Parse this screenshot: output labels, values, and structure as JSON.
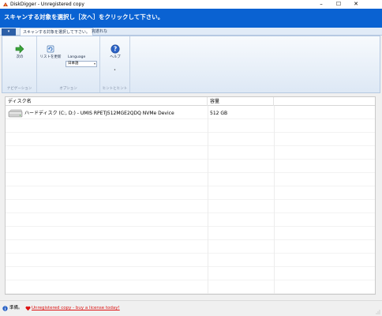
{
  "window": {
    "title": "DiskDigger - Unregistered copy",
    "controls": {
      "minimize": "–",
      "maximize": "☐",
      "close": "✕"
    }
  },
  "banner": {
    "text": "スキャンする対象を選択し［次へ］をクリックして下さい。"
  },
  "ribbon": {
    "file_tab": "▾",
    "tabs": [
      {
        "label": "スキャンする対象を選択して下さい。",
        "active": true
      },
      {
        "label": "完遂れな",
        "active": false
      }
    ],
    "groups": {
      "navigation": {
        "label": "ナビゲーション",
        "next_label": "次の"
      },
      "options": {
        "label": "オプション",
        "refresh_label": "リストを更新",
        "language_label": "Language",
        "language_value": "日本語"
      },
      "help": {
        "label": "ヒントとヒント",
        "help_label": "ヘルプ",
        "dot": "•"
      }
    }
  },
  "list": {
    "columns": [
      "ディスク名",
      "容量"
    ],
    "rows": [
      {
        "name": "ハードディスク (C:, D:) - UMIS RPETJ512MGE2QDQ NVMe Device",
        "size": "512 GB",
        "icon": "hard-disk-icon"
      }
    ]
  },
  "status": {
    "ready_text": "準備。",
    "link_text": "Unregistered copy - buy a license today!"
  },
  "colors": {
    "banner": "#0a62d2",
    "link": "#dd1111",
    "file_tab": "#2c5fa7"
  }
}
